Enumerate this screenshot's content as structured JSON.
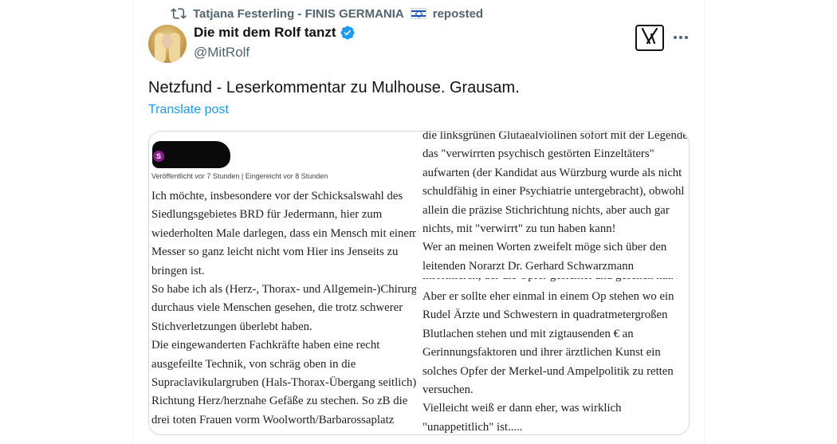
{
  "repost": {
    "reposter_name": "Tatjana Festerling - FINIS GERMANIA",
    "flag_icon": "israel-flag-icon",
    "label": "reposted"
  },
  "author": {
    "name": "Die mit dem Rolf tanzt",
    "handle": "@MitRolf",
    "verified": true,
    "verified_color": "#1d9bf0"
  },
  "post": {
    "text": "Netzfund - Leserkommentar zu Mulhouse. Grausam.",
    "translate_label": "Translate post"
  },
  "media": {
    "badge_letter": "S",
    "meta": "Veröffentlicht vor 7 Stunden | Eingereicht vor 8 Stunden",
    "left_lines": [
      "Ich möchte, insbesondere vor der Schicksalswahl des",
      "Siedlungsgebietes BRD für Jedermann, hier zum",
      "wiederholten Male darlegen, dass ein Mensch mit einem",
      "Messer so ganz leicht nicht vom Hier ins Jenseits zu",
      "bringen ist.",
      "So habe ich als (Herz-, Thorax- und Allgemein-)Chirurg",
      "durchaus viele Menschen gesehen, die trotz schwerer",
      "Stichverletzungen überlebt haben.",
      "Die eingewanderten Fachkräfte haben eine recht",
      "ausgefeilte Technik, von schräg oben in die",
      "Supraclavikulargruben (Hals-Thorax-Übergang seitlich)",
      "Richtung Herz/herznahe Gefäße zu stechen. So zB die",
      "drei toten Frauen vorm Woolworth/Barbarossaplatz"
    ],
    "right_top_lines": [
      "die linksgrünen Glutaealviolinen sofort mit der Legende",
      "das \"verwirrten psychisch gestörten Einzeltäters\"",
      "aufwarten (der Kandidat aus Würzburg wurde als nicht",
      "schuldfähig in einer Psychiatrie untergebracht), obwohl",
      "allein die präzise Stichrichtung nichts, aber auch gar",
      "nichts, mit \"verwirrt\" zu tun haben kann!",
      "Wer an meinen Worten zweifelt möge sich über den",
      "leitenden Norarzt Dr. Gerhard Schwarzmann"
    ],
    "right_cut_line": "informieren, der die Opfer gesichtet und gesehen hat. Er",
    "right_bottom_lines": [
      "Aber er sollte eher einmal in einem Op stehen wo ein",
      "Rudel Ärzte und Schwestern in quadratmetergroßen",
      "Blutlachen stehen und mit zigtausenden € an",
      "Gerinnungsfaktoren und ihrer ärztlichen Kunst ein",
      "solches Opfer der Merkel-und Ampelpolitik zu retten",
      "versuchen.",
      "Vielleicht weiß er dann eher, was wirklich",
      "\"unappetitlich\" ist....."
    ]
  }
}
